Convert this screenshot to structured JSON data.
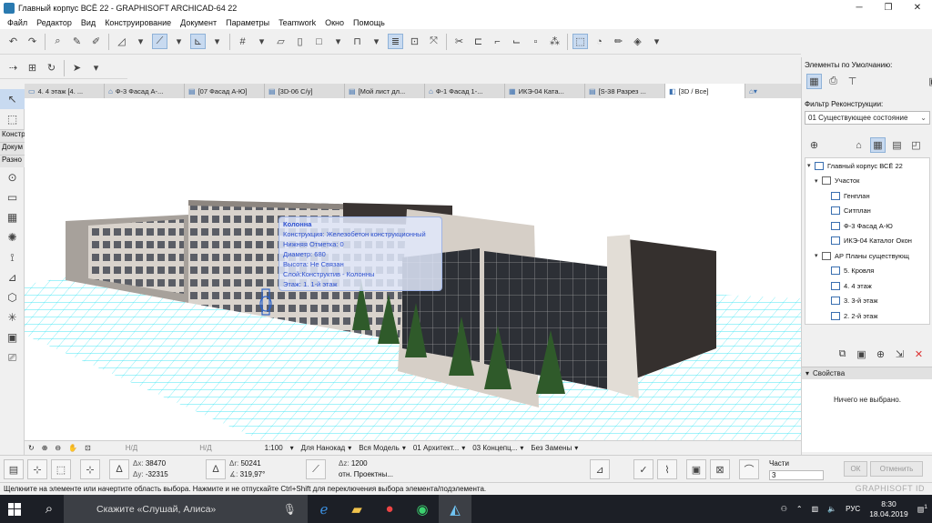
{
  "window": {
    "title": "Главный корпус ВСЁ 22 - GRAPHISOFT ARCHICAD-64 22"
  },
  "menu": [
    "Файл",
    "Редактор",
    "Вид",
    "Конструирование",
    "Документ",
    "Параметры",
    "Teamwork",
    "Окно",
    "Помощь"
  ],
  "toolbox": {
    "groups": [
      "Констр",
      "Докум",
      "Разно"
    ]
  },
  "tabs": [
    {
      "label": "4. 4 этаж [4. ...",
      "icon": "floor-plan-icon"
    },
    {
      "label": "Ф-3 Фасад А-...",
      "icon": "elevation-icon"
    },
    {
      "label": "[07 Фасад А-Ю]",
      "icon": "layout-icon"
    },
    {
      "label": "[3D-06 C/у]",
      "icon": "layout-icon"
    },
    {
      "label": "[Мой лист дл...",
      "icon": "layout-icon"
    },
    {
      "label": "Ф-1 Фасад 1-...",
      "icon": "elevation-icon"
    },
    {
      "label": "ИКЭ-04 Ката...",
      "icon": "schedule-icon"
    },
    {
      "label": "[S-38 Разрез ...",
      "icon": "layout-icon"
    },
    {
      "label": "[3D / Все]",
      "icon": "3d-view-icon",
      "active": true
    }
  ],
  "tooltip": {
    "title": "Колонна",
    "lines": [
      "Конструкция: Железобетон конструкционный",
      "Нижняя Отметка: 0",
      "Диаметр: 680",
      "Высота: Не Связан",
      "Слой:Конструктив - Колонны",
      "Этаж: 1. 1-й этаж"
    ]
  },
  "right_panel": {
    "defaults_label": "Элементы по Умолчанию:",
    "filter_label": "Фильтр Реконструкции:",
    "filter_value": "01 Существующее состояние",
    "tree": [
      {
        "label": "Главный корпус ВСЁ 22",
        "level": 0,
        "chev": "▾",
        "icon": "project-icon"
      },
      {
        "label": "Участок",
        "level": 1,
        "chev": "▾",
        "icon": "folder-icon"
      },
      {
        "label": "Генплан",
        "level": 2,
        "chev": "",
        "icon": "floor-plan-icon"
      },
      {
        "label": "Ситплан",
        "level": 2,
        "chev": "",
        "icon": "floor-plan-icon"
      },
      {
        "label": "Ф-3 Фасад А-Ю",
        "level": 2,
        "chev": "",
        "icon": "elevation-icon"
      },
      {
        "label": "ИКЭ-04 Каталог Окон",
        "level": 2,
        "chev": "",
        "icon": "schedule-icon"
      },
      {
        "label": "АР Планы существующ",
        "level": 1,
        "chev": "▾",
        "icon": "folder-icon"
      },
      {
        "label": "5. Кровля",
        "level": 2,
        "chev": "",
        "icon": "floor-plan-icon"
      },
      {
        "label": "4. 4 этаж",
        "level": 2,
        "chev": "",
        "icon": "floor-plan-icon"
      },
      {
        "label": "3. 3-й этаж",
        "level": 2,
        "chev": "",
        "icon": "floor-plan-icon"
      },
      {
        "label": "2. 2-й этаж",
        "level": 2,
        "chev": "",
        "icon": "floor-plan-icon"
      }
    ],
    "properties_label": "Свойства",
    "nothing_selected": "Ничего не выбрано."
  },
  "navbar": {
    "undef1": "Н/Д",
    "undef2": "Н/Д",
    "scale": "1:100",
    "overrides": "Для Нанокад",
    "model": "Вся Модель",
    "layer_combo": "01 Архитект...",
    "dim": "03 Концепц...",
    "renovation": "Без Замены"
  },
  "infobox": {
    "dx_label": "Δx:",
    "dx": "38470",
    "dy_label": "Δy:",
    "dy": "-32315",
    "dr_label": "Δr:",
    "dr": "50241",
    "angle_label": "∡:",
    "angle": "319,97°",
    "dz_label": "Δz:",
    "dz": "1200",
    "ref_label": "отн. Проектны...",
    "parts_label": "Части",
    "parts_value": "3",
    "ok_label": "ОК",
    "cancel_label": "Отменить"
  },
  "status": {
    "text": "Щелкните на элементе или начертите область выбора. Нажмите и не отпускайте Ctrl+Shift для переключения выбора элемента/подэлемента.",
    "brand": "GRAPHISOFT ID"
  },
  "taskbar": {
    "search_placeholder": "Скажите «Слушай, Алиса»",
    "lang": "РУС",
    "time": "8:30",
    "date": "18.04.2019",
    "notif_count": "1"
  }
}
